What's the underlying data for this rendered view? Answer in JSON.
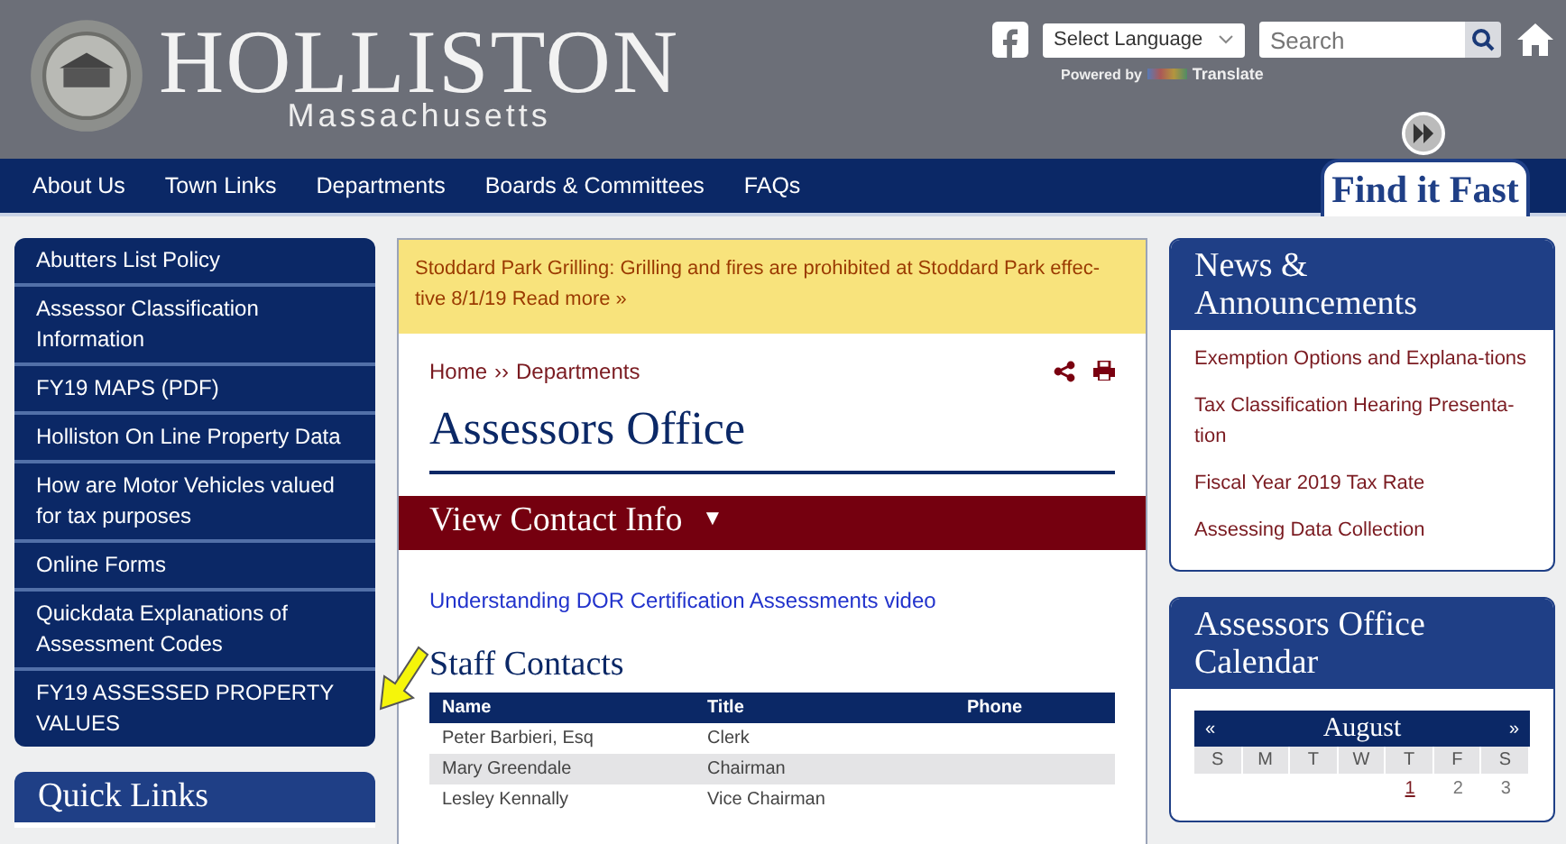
{
  "header": {
    "title": "HOLLISTON",
    "subtitle": "Massachusetts",
    "language_select": "Select Language",
    "powered_by": "Powered by",
    "translate": "Translate",
    "search": {
      "placeholder": "Search"
    },
    "find_it_fast": "Find it Fast"
  },
  "nav": [
    "About Us",
    "Town Links",
    "Departments",
    "Boards & Committees",
    "FAQs"
  ],
  "sidebar": {
    "items": [
      "Abutters List Policy",
      "Assessor Classification Information",
      "FY19 MAPS (PDF)",
      "Holliston On Line Property Data",
      "How are Motor Vehicles valued for tax purposes",
      "Online Forms",
      "Quickdata Explanations of Assessment Codes",
      "FY19 ASSESSED PROPERTY VALUES"
    ],
    "quick_links": "Quick Links"
  },
  "alert": "Stoddard Park Grilling: Grilling and fires are prohibited at Stoddard Park effec-tive 8/1/19 Read more »",
  "breadcrumb": [
    "Home",
    "››",
    "Departments"
  ],
  "page_title": "Assessors Office",
  "contact_bar": {
    "label": "View Contact Info",
    "caret": "▼"
  },
  "video_link": "Understanding DOR Certification Assessments video",
  "staff": {
    "heading": "Staff Contacts",
    "columns": [
      "Name",
      "Title",
      "Phone"
    ],
    "rows": [
      [
        "Peter Barbieri, Esq",
        "Clerk"
      ],
      [
        "Mary Greendale",
        "Chairman"
      ],
      [
        "Lesley Kennally",
        "Vice Chairman"
      ]
    ]
  },
  "news": {
    "heading": "News & Announcements",
    "items": [
      "Exemption Options and Explana-tions",
      "Tax Classification Hearing Presenta-tion",
      "Fiscal Year 2019 Tax Rate",
      "Assessing Data Collection"
    ]
  },
  "calendar": {
    "heading": "Assessors Office Calendar",
    "prev": "«",
    "month": "August",
    "next": "»",
    "weekdays": [
      "S",
      "M",
      "T",
      "W",
      "T",
      "F",
      "S"
    ],
    "dates": [
      {
        "day": "1",
        "has_event": true
      },
      {
        "day": "2",
        "has_event": false
      },
      {
        "day": "3",
        "has_event": false
      }
    ]
  }
}
